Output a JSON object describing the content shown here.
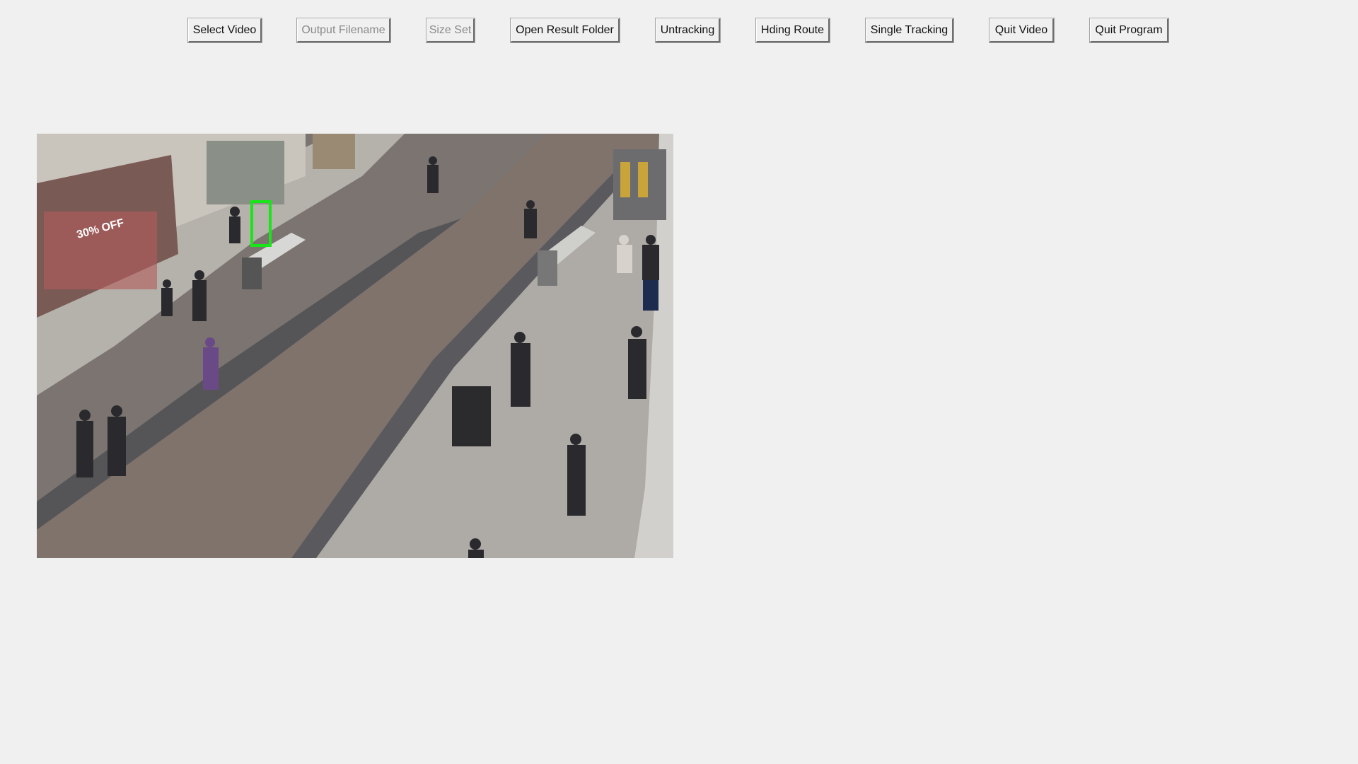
{
  "toolbar": {
    "buttons": [
      {
        "label": "Select Video",
        "enabled": true
      },
      {
        "label": "Output Filename",
        "enabled": false
      },
      {
        "label": "Size Set",
        "enabled": false
      },
      {
        "label": "Open Result Folder",
        "enabled": true
      },
      {
        "label": "Untracking",
        "enabled": true
      },
      {
        "label": "Hding Route",
        "enabled": true
      },
      {
        "label": "Single Tracking",
        "enabled": true
      },
      {
        "label": "Quit Video",
        "enabled": true
      },
      {
        "label": "Quit Program",
        "enabled": true
      }
    ]
  },
  "video": {
    "scene": "pedestrian street surveillance frame",
    "shop_sign": "30% OFF",
    "tracking_box_color": "#19e619"
  }
}
